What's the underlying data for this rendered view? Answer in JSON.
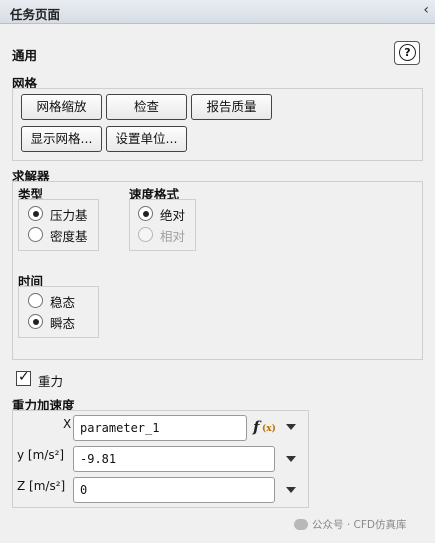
{
  "panel": {
    "title": "任务页面",
    "collapse_icon": "‹"
  },
  "general": {
    "title": "通用",
    "help_label": "?"
  },
  "mesh": {
    "title": "网格",
    "buttons": {
      "scale": "网格缩放",
      "check": "检查",
      "report_quality": "报告质量",
      "display": "显示网格...",
      "units": "设置单位..."
    }
  },
  "solver": {
    "title": "求解器",
    "type": {
      "title": "类型",
      "options": [
        "压力基",
        "密度基"
      ],
      "selected": "压力基"
    },
    "velocity_formulation": {
      "title": "速度格式",
      "options": [
        "绝对",
        "相对"
      ],
      "selected": "绝对"
    },
    "time": {
      "title": "时间",
      "options": [
        "稳态",
        "瞬态"
      ],
      "selected": "瞬态"
    }
  },
  "gravity": {
    "checkbox_label": "重力",
    "checked": true,
    "acceleration_title": "重力加速度",
    "x": {
      "label": "X",
      "value": "parameter_1"
    },
    "y": {
      "label": "y [m/s²]",
      "value": "-9.81"
    },
    "z": {
      "label": "Z [m/s²]",
      "value": "0"
    }
  },
  "watermark": {
    "text": "公众号 · CFD仿真库"
  }
}
